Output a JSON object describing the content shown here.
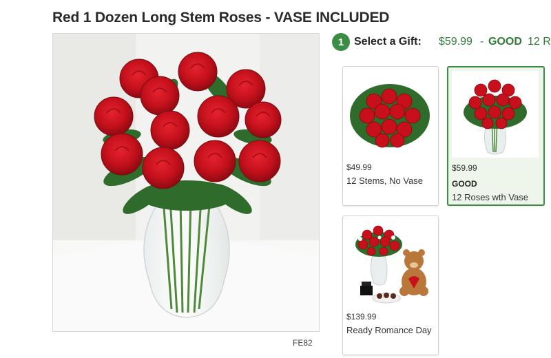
{
  "product": {
    "title": "Red 1 Dozen Long Stem Roses - VASE INCLUDED",
    "sku": "FE82"
  },
  "selector": {
    "step_number": "1",
    "label": "Select a Gift:",
    "selected_price": "$59.99",
    "separator": "-",
    "selected_badge": "GOOD",
    "selected_suffix": "12 R"
  },
  "options": [
    {
      "price": "$49.99",
      "name": "12 Stems, No Vase",
      "selected": false
    },
    {
      "price": "$59.99",
      "badge": "GOOD",
      "name": "12 Roses wth Vase",
      "selected": true
    },
    {
      "price": "$139.99",
      "name": "Ready Romance Day",
      "selected": false
    }
  ],
  "colors": {
    "accent_green": "#3b8c45",
    "price_green": "#2f7a36",
    "rose_red": "#c8101c",
    "leaf_green": "#2f6b2a"
  }
}
